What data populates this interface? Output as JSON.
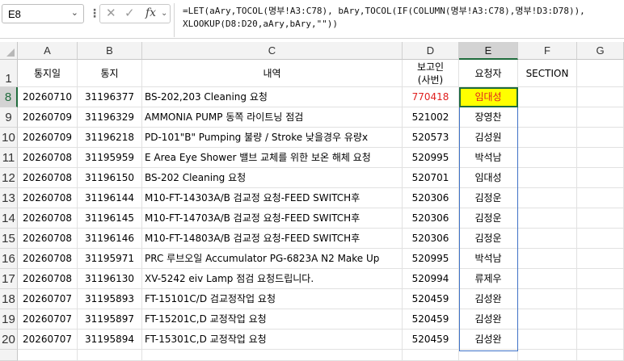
{
  "name_box": {
    "value": "E8"
  },
  "formula_bar": {
    "cancel_glyph": "✕",
    "enter_glyph": "✓",
    "fx_label": "fx",
    "formula_line1": "=LET(aAry,TOCOL(명부!A3:C78), bAry,TOCOL(IF(COLUMN(명부!A3:C78),명부!D3:D78)),",
    "formula_line2": "XLOOKUP(D8:D20,aAry,bAry,\"\"))"
  },
  "columns": [
    "A",
    "B",
    "C",
    "D",
    "E",
    "F",
    "G"
  ],
  "selected_column": "E",
  "selected_row": 8,
  "header_row": {
    "row_number": "1",
    "A": "통지일",
    "B": "통지",
    "C": "내역",
    "D_line1": "보고인",
    "D_line2": "(사번)",
    "E": "요청자",
    "F": "SECTION"
  },
  "rows": [
    {
      "row": "8",
      "A": "20260710",
      "B": "31196377",
      "C": "BS-202,203 Cleaning 요청",
      "D": "770418",
      "E": "임대성",
      "comment": false
    },
    {
      "row": "9",
      "A": "20260709",
      "B": "31196329",
      "C": "AMMONIA PUMP 동쪽 라이트닝 점검",
      "D": "521002",
      "E": "장영찬",
      "comment": false
    },
    {
      "row": "10",
      "A": "20260709",
      "B": "31196218",
      "C": "PD-101\"B\" Pumping 불량 / Stroke 낮을경우 유량x",
      "D": "520573",
      "E": "김성원",
      "comment": true
    },
    {
      "row": "11",
      "A": "20260708",
      "B": "31195959",
      "C": "E Area Eye Shower 밸브 교체를 위한 보온 해체 요청",
      "D": "520995",
      "E": "박석남",
      "comment": true
    },
    {
      "row": "12",
      "A": "20260708",
      "B": "31196150",
      "C": "BS-202 Cleaning 요청",
      "D": "520701",
      "E": "임대성",
      "comment": false
    },
    {
      "row": "13",
      "A": "20260708",
      "B": "31196144",
      "C": "M10-FT-14303A/B 검교정 요청-FEED SWITCH후",
      "D": "520306",
      "E": "김정운",
      "comment": false
    },
    {
      "row": "14",
      "A": "20260708",
      "B": "31196145",
      "C": "M10-FT-14703A/B 검교정 요청-FEED SWITCH후",
      "D": "520306",
      "E": "김정운",
      "comment": false
    },
    {
      "row": "15",
      "A": "20260708",
      "B": "31196146",
      "C": "M10-FT-14803A/B 검교정 요청-FEED SWITCH후",
      "D": "520306",
      "E": "김정운",
      "comment": false
    },
    {
      "row": "16",
      "A": "20260708",
      "B": "31195971",
      "C": "PRC 루브오일 Accumulator PG-6823A N2 Make Up",
      "D": "520995",
      "E": "박석남",
      "comment": false
    },
    {
      "row": "17",
      "A": "20260708",
      "B": "31196130",
      "C": "XV-5242 eiv Lamp 점검 요청드립니다.",
      "D": "520994",
      "E": "류제우",
      "comment": true
    },
    {
      "row": "18",
      "A": "20260707",
      "B": "31195893",
      "C": "FT-15101C/D 검교정작업 요청",
      "D": "520459",
      "E": "김성완",
      "comment": true
    },
    {
      "row": "19",
      "A": "20260707",
      "B": "31195897",
      "C": "FT-15201C,D 교정작업 요청",
      "D": "520459",
      "E": "김성완",
      "comment": true
    },
    {
      "row": "20",
      "A": "20260707",
      "B": "31195894",
      "C": "FT-15301C,D 교정작업 요청",
      "D": "520459",
      "E": "김성완",
      "comment": false
    }
  ],
  "colors": {
    "selected_fill": "#ffff00",
    "red_text": "#e0201f",
    "selection_border": "#1f6b3c",
    "spill_border": "#3f72c7"
  }
}
